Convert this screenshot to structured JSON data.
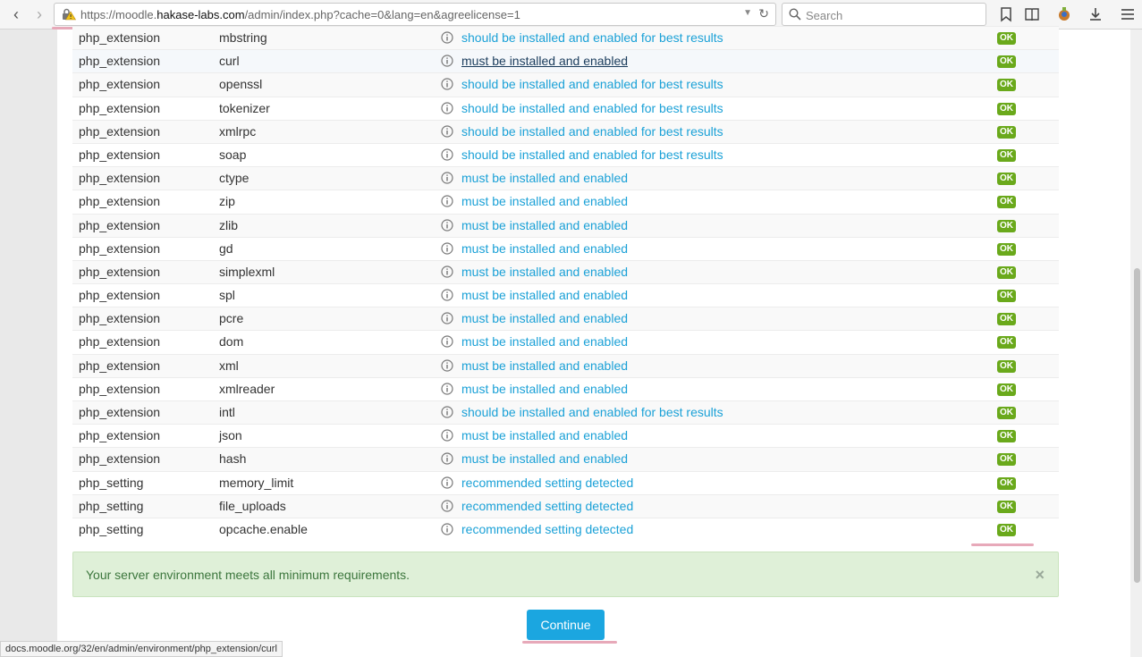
{
  "browser": {
    "url_prefix": "https://moodle.",
    "url_host": "hakase-labs.com",
    "url_path": "/admin/index.php?cache=0&lang=en&agreelicense=1",
    "search_placeholder": "Search",
    "status_url": "docs.moodle.org/32/en/admin/environment/php_extension/curl"
  },
  "environment": {
    "rows": [
      {
        "type": "php_extension",
        "name": "mbstring",
        "report": "should be installed and enabled for best results",
        "status": "OK"
      },
      {
        "type": "php_extension",
        "name": "curl",
        "report": "must be installed and enabled",
        "status": "OK"
      },
      {
        "type": "php_extension",
        "name": "openssl",
        "report": "should be installed and enabled for best results",
        "status": "OK"
      },
      {
        "type": "php_extension",
        "name": "tokenizer",
        "report": "should be installed and enabled for best results",
        "status": "OK"
      },
      {
        "type": "php_extension",
        "name": "xmlrpc",
        "report": "should be installed and enabled for best results",
        "status": "OK"
      },
      {
        "type": "php_extension",
        "name": "soap",
        "report": "should be installed and enabled for best results",
        "status": "OK"
      },
      {
        "type": "php_extension",
        "name": "ctype",
        "report": "must be installed and enabled",
        "status": "OK"
      },
      {
        "type": "php_extension",
        "name": "zip",
        "report": "must be installed and enabled",
        "status": "OK"
      },
      {
        "type": "php_extension",
        "name": "zlib",
        "report": "must be installed and enabled",
        "status": "OK"
      },
      {
        "type": "php_extension",
        "name": "gd",
        "report": "must be installed and enabled",
        "status": "OK"
      },
      {
        "type": "php_extension",
        "name": "simplexml",
        "report": "must be installed and enabled",
        "status": "OK"
      },
      {
        "type": "php_extension",
        "name": "spl",
        "report": "must be installed and enabled",
        "status": "OK"
      },
      {
        "type": "php_extension",
        "name": "pcre",
        "report": "must be installed and enabled",
        "status": "OK"
      },
      {
        "type": "php_extension",
        "name": "dom",
        "report": "must be installed and enabled",
        "status": "OK"
      },
      {
        "type": "php_extension",
        "name": "xml",
        "report": "must be installed and enabled",
        "status": "OK"
      },
      {
        "type": "php_extension",
        "name": "xmlreader",
        "report": "must be installed and enabled",
        "status": "OK"
      },
      {
        "type": "php_extension",
        "name": "intl",
        "report": "should be installed and enabled for best results",
        "status": "OK"
      },
      {
        "type": "php_extension",
        "name": "json",
        "report": "must be installed and enabled",
        "status": "OK"
      },
      {
        "type": "php_extension",
        "name": "hash",
        "report": "must be installed and enabled",
        "status": "OK"
      },
      {
        "type": "php_setting",
        "name": "memory_limit",
        "report": "recommended setting detected",
        "status": "OK"
      },
      {
        "type": "php_setting",
        "name": "file_uploads",
        "report": "recommended setting detected",
        "status": "OK"
      },
      {
        "type": "php_setting",
        "name": "opcache.enable",
        "report": "recommended setting detected",
        "status": "OK"
      }
    ]
  },
  "alert": {
    "message": "Your server environment meets all minimum requirements.",
    "close": "×"
  },
  "continue_label": "Continue",
  "colors": {
    "link": "#1ba1d7",
    "ok_badge": "#6aa91b",
    "alert_bg": "#dff0d8",
    "button": "#1ba6e0"
  }
}
